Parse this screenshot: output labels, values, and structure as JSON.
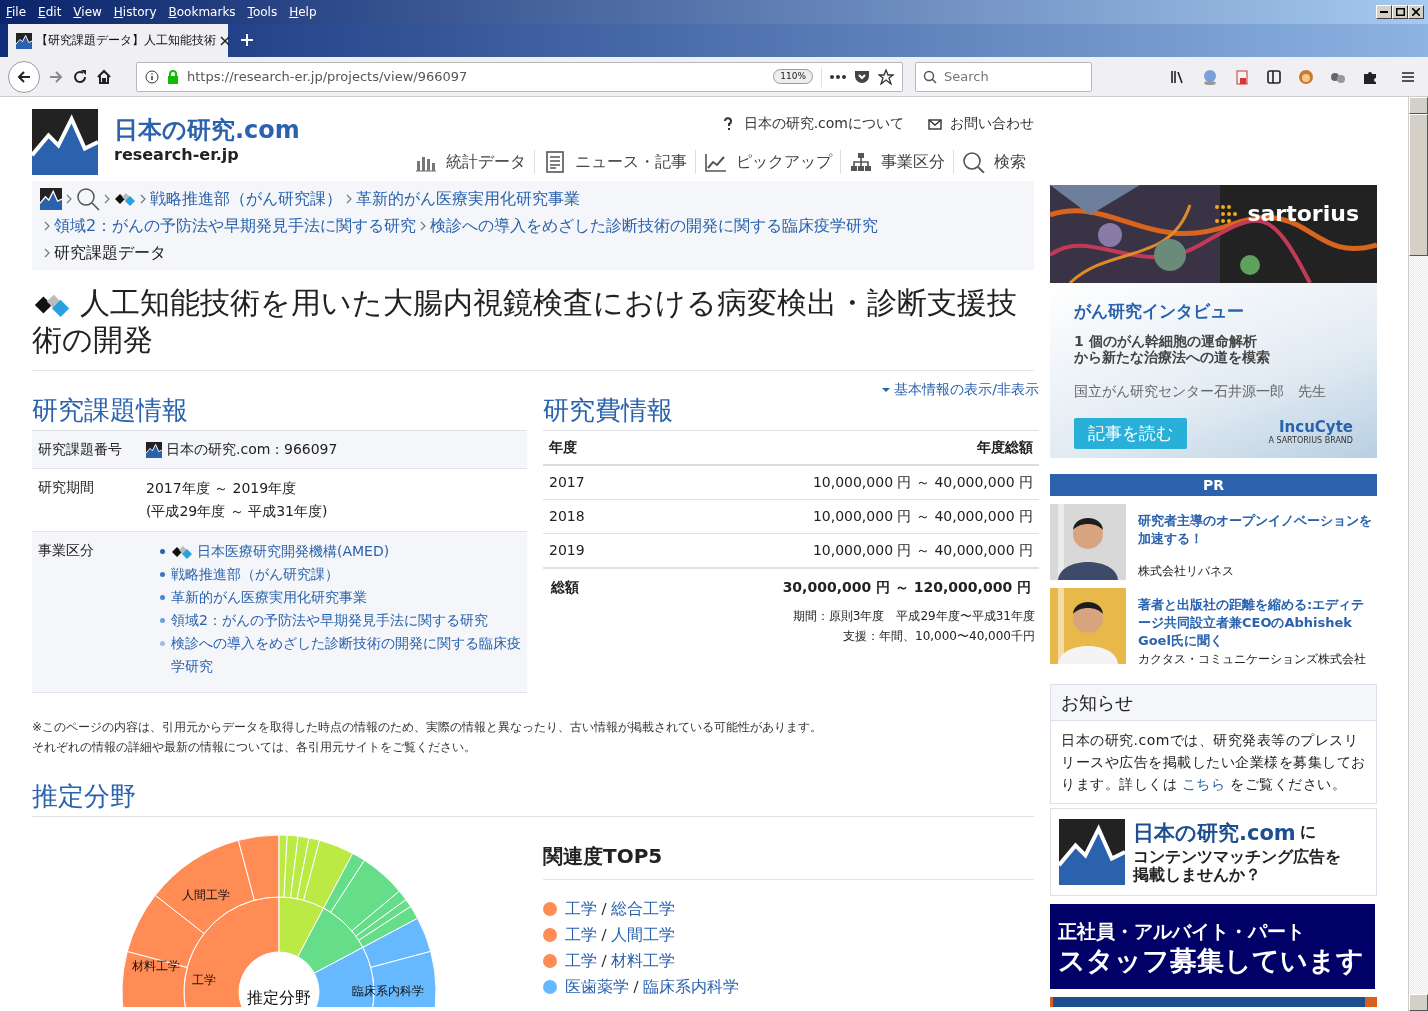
{
  "browser": {
    "menu": [
      "File",
      "Edit",
      "View",
      "History",
      "Bookmarks",
      "Tools",
      "Help"
    ],
    "tab": {
      "title": "【研究課題データ】人工知能技術",
      "selected": true
    },
    "url": "https://research-er.jp/projects/view/966097",
    "zoom": "110%",
    "search": {
      "placeholder": "Search"
    }
  },
  "site": {
    "logo_title": "日本の研究.com",
    "logo_sub": "research-er.jp",
    "top_links": [
      {
        "label": "日本の研究.comについて"
      },
      {
        "label": "お問い合わせ"
      }
    ],
    "nav": [
      {
        "label": "統計データ"
      },
      {
        "label": "ニュース・記事"
      },
      {
        "label": "ピックアップ"
      },
      {
        "label": "事業区分"
      },
      {
        "label": "検索"
      }
    ]
  },
  "breadcrumb": [
    [
      {
        "kind": "logo"
      },
      {
        "kind": "search"
      },
      {
        "kind": "diamond"
      },
      {
        "kind": "link",
        "label": "戦略推進部（がん研究課）"
      },
      {
        "kind": "link",
        "label": "革新的がん医療実用化研究事業"
      }
    ],
    [
      {
        "kind": "link",
        "label": "領域2：がんの予防法や早期発見手法に関する研究"
      },
      {
        "kind": "link",
        "label": "検診への導入をめざした診断技術の開発に関する臨床疫学研究"
      }
    ],
    [
      {
        "kind": "current",
        "label": "研究課題データ"
      }
    ]
  ],
  "title": "人工知能技術を用いた大腸内視鏡検査における病変検出・診断支援技術の開発",
  "toggle": "基本情報の表示/非表示",
  "project_info": {
    "heading": "研究課題情報",
    "rows": [
      {
        "kind": "id",
        "label": "研究課題番号",
        "value": "日本の研究.com : 966097"
      },
      {
        "kind": "lines",
        "label": "研究期間",
        "lines": [
          "2017年度 ～ 2019年度",
          "(平成29年度 ～ 平成31年度)"
        ]
      },
      {
        "kind": "list",
        "label": "事業区分",
        "items": [
          {
            "label": "日本医療研究開発機構(AMED)",
            "color": "#2a62ad",
            "diamond": true
          },
          {
            "label": "戦略推進部（がん研究課）",
            "color": "#3a74c2",
            "diamond": false
          },
          {
            "label": "革新的がん医療実用化研究事業",
            "color": "#4a86d2",
            "diamond": false
          },
          {
            "label": "領域2：がんの予防法や早期発見手法に関する研究",
            "color": "#6c9fe0",
            "diamond": false
          },
          {
            "label": "検診への導入をめざした診断技術の開発に関する臨床疫学研究",
            "color": "#9dbdea",
            "diamond": false
          }
        ]
      }
    ]
  },
  "funding": {
    "heading": "研究費情報",
    "columns": [
      "年度",
      "年度総額"
    ],
    "rows": [
      {
        "year": "2017",
        "amount": "10,000,000 円 ～ 40,000,000 円"
      },
      {
        "year": "2018",
        "amount": "10,000,000 円 ～ 40,000,000 円"
      },
      {
        "year": "2019",
        "amount": "10,000,000 円 ～ 40,000,000 円"
      }
    ],
    "total": {
      "label": "総額",
      "amount": "30,000,000 円 ～ 120,000,000 円"
    },
    "notes": [
      "期間：原則3年度　平成29年度〜平成31年度",
      "支援：年間、10,000〜40,000千円"
    ]
  },
  "disclaimer": [
    "※このページの内容は、引用元からデータを取得した時点の情報のため、実際の情報と異なったり、古い情報が掲載されている可能性があります。",
    "それぞれの情報の詳細や最新の情報については、各引用元サイトをご覧ください。"
  ],
  "fields": {
    "heading": "推定分野",
    "chart_labels": [
      "人間工学",
      "材料工学",
      "工学",
      "推定分野",
      "臨床系内科学"
    ],
    "top5": {
      "heading": "関連度TOP5",
      "items": [
        {
          "color": "#ff8c55",
          "parts": [
            "工学",
            "総合工学"
          ]
        },
        {
          "color": "#ff8c55",
          "parts": [
            "工学",
            "人間工学"
          ]
        },
        {
          "color": "#ff8c55",
          "parts": [
            "工学",
            "材料工学"
          ]
        },
        {
          "color": "#66b8ff",
          "parts": [
            "医歯薬学",
            "臨床系内科学"
          ]
        }
      ]
    }
  },
  "sidebar": {
    "ad": {
      "brand": "sartorius",
      "heading": "がん研究インタビュー",
      "lead": [
        "1 個のがん幹細胞の運命解析",
        "から新たな治療法への道を模索"
      ],
      "person": "国立がん研究センター石井源一郎　先生",
      "button": "記事を読む",
      "logo": "IncuCyte",
      "logo_sub": "A SARTORIUS BRAND"
    },
    "pr": {
      "heading": "PR",
      "items": [
        {
          "title": "研究者主導のオープンイノベーションを加速する！",
          "company": "株式会社リバネス",
          "kind": "picture"
        },
        {
          "title": "著者と出版社の距離を縮める:エディテージ共同設立者兼CEOのAbhishek Goel氏に聞く",
          "company": "カクタス・コミュニケーションズ株式会社",
          "kind": "picture"
        }
      ]
    },
    "notice": {
      "heading": "お知らせ",
      "before": "日本の研究.comでは、研究発表等のプレスリリースや広告を掲載したい企業様を募集しております。詳しくは",
      "link": "こちら",
      "after": "をご覧ください。"
    },
    "ad2": {
      "title": "日本の研究.com",
      "suffix": "に",
      "lines": [
        "コンテンツマッチング広告を",
        "掲載しませんか？"
      ]
    },
    "ad3": {
      "lines": [
        "正社員・アルバイト・パート",
        "スタッフ募集しています"
      ]
    }
  }
}
